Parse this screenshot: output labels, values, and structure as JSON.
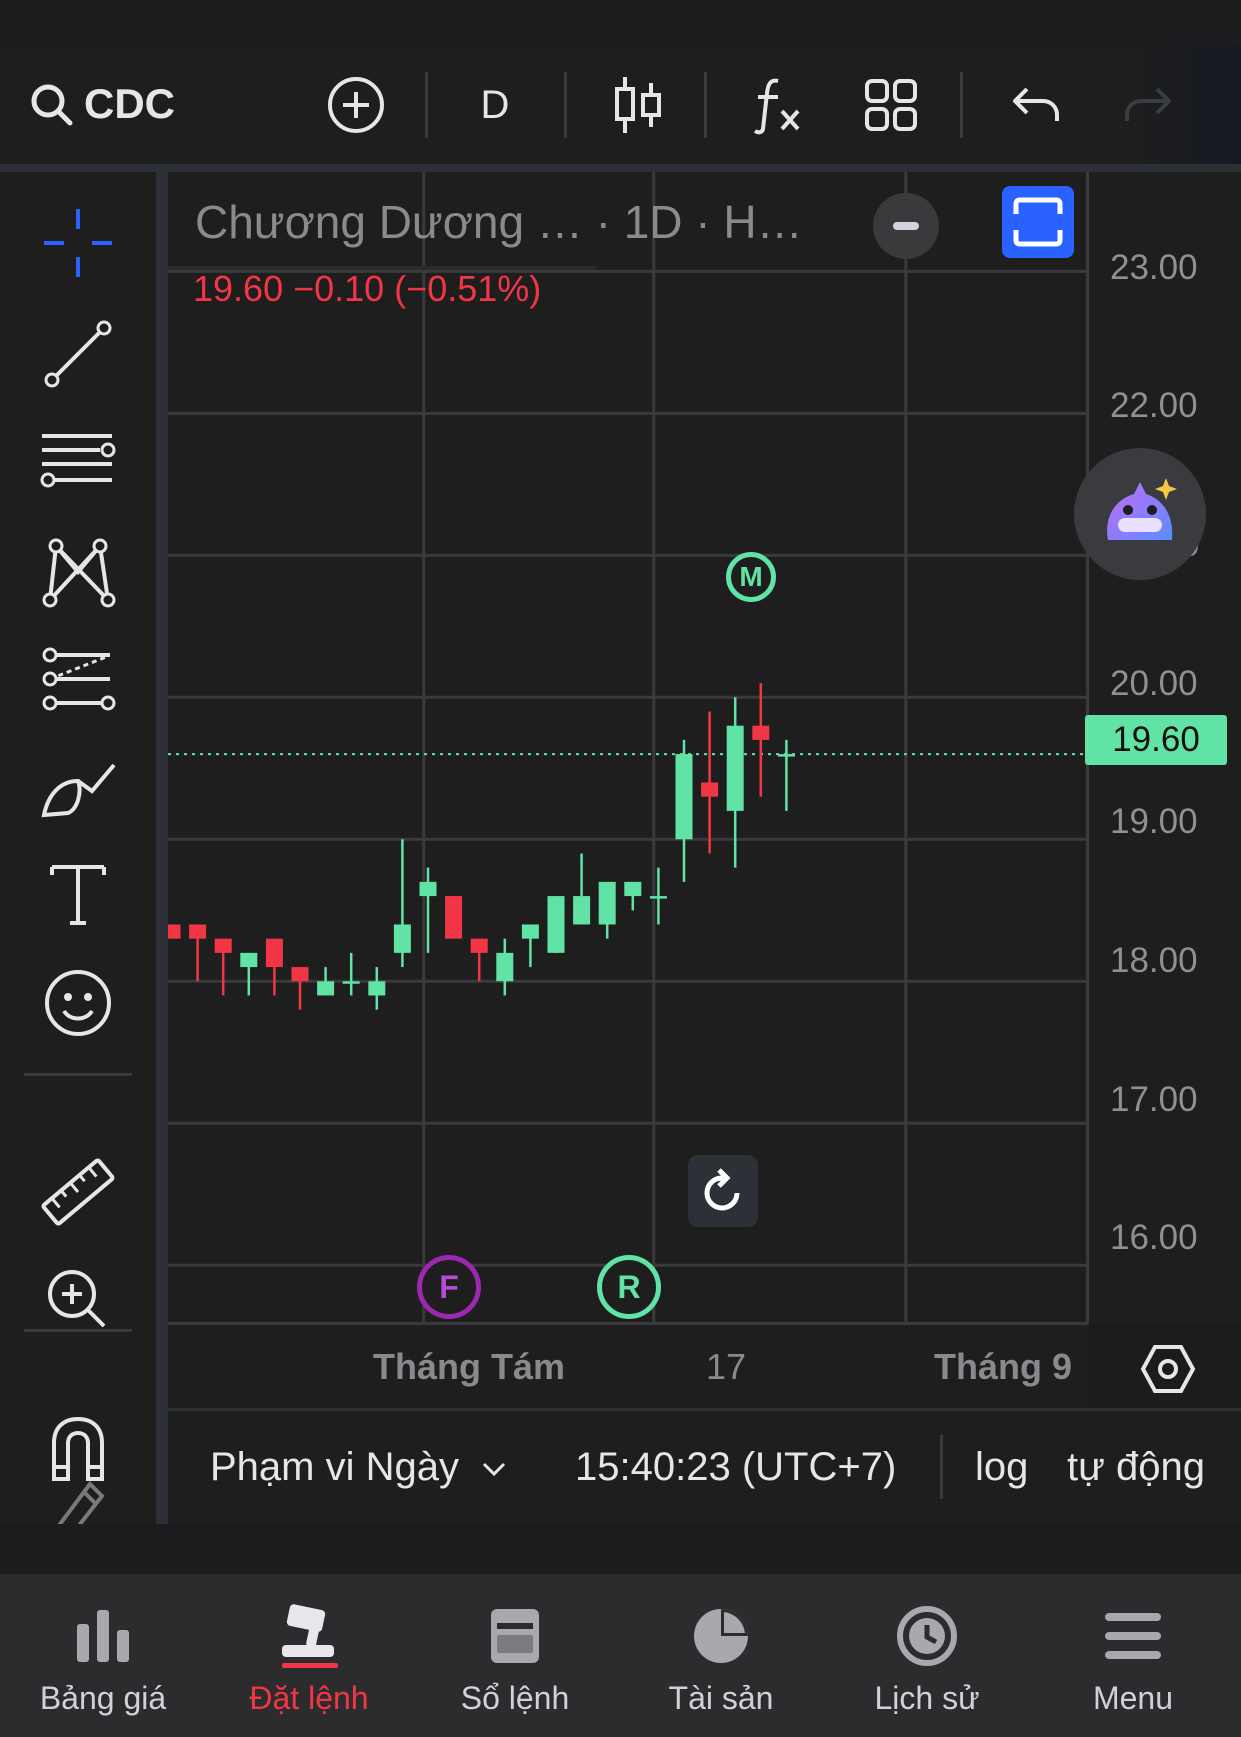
{
  "toolbar": {
    "symbol": "CDC",
    "interval": "D"
  },
  "legend": {
    "name": "Chương Dương … · 1D · H…",
    "price_change": "19.60  −0.10 (−0.51%)"
  },
  "colors": {
    "up": "#61e3a5",
    "down": "#f23645",
    "accent": "#2962ff",
    "background": "#1e1e1e"
  },
  "price_scale": {
    "ticks": [
      "23.00",
      "22.00",
      "20.00",
      "19.00",
      "18.00",
      "17.00",
      "16.00"
    ],
    "partial_tick": "0",
    "last_price": "19.60"
  },
  "time_axis": {
    "labels": [
      "Tháng Tám",
      "17",
      "Tháng 9"
    ]
  },
  "markers": {
    "m": "M",
    "f": "F",
    "r": "R"
  },
  "chart_data": {
    "type": "candlestick",
    "ylim": [
      15.6,
      23.7
    ],
    "last_price": 19.6,
    "x_labels": [
      "Tháng Tám",
      "17",
      "Tháng 9"
    ],
    "candles": [
      {
        "o": 18.4,
        "h": 18.4,
        "c": 18.3,
        "l": 18.3
      },
      {
        "o": 18.4,
        "h": 18.4,
        "c": 18.3,
        "l": 18.0
      },
      {
        "o": 18.3,
        "h": 18.3,
        "c": 18.2,
        "l": 17.9
      },
      {
        "o": 18.1,
        "h": 18.2,
        "c": 18.2,
        "l": 17.9
      },
      {
        "o": 18.3,
        "h": 18.3,
        "c": 18.1,
        "l": 17.9
      },
      {
        "o": 18.1,
        "h": 18.1,
        "c": 18.0,
        "l": 17.8
      },
      {
        "o": 17.9,
        "h": 18.1,
        "c": 18.0,
        "l": 17.9
      },
      {
        "o": 18.0,
        "h": 18.2,
        "c": 18.0,
        "l": 17.9
      },
      {
        "o": 17.9,
        "h": 18.1,
        "c": 18.0,
        "l": 17.8
      },
      {
        "o": 18.2,
        "h": 19.0,
        "c": 18.4,
        "l": 18.1
      },
      {
        "o": 18.6,
        "h": 18.8,
        "c": 18.7,
        "l": 18.2
      },
      {
        "o": 18.6,
        "h": 18.6,
        "c": 18.3,
        "l": 18.3
      },
      {
        "o": 18.3,
        "h": 18.3,
        "c": 18.2,
        "l": 18.0
      },
      {
        "o": 18.0,
        "h": 18.3,
        "c": 18.2,
        "l": 17.9
      },
      {
        "o": 18.3,
        "h": 18.4,
        "c": 18.4,
        "l": 18.1
      },
      {
        "o": 18.2,
        "h": 18.6,
        "c": 18.6,
        "l": 18.2
      },
      {
        "o": 18.4,
        "h": 18.9,
        "c": 18.6,
        "l": 18.4
      },
      {
        "o": 18.4,
        "h": 18.7,
        "c": 18.7,
        "l": 18.3
      },
      {
        "o": 18.6,
        "h": 18.7,
        "c": 18.7,
        "l": 18.5
      },
      {
        "o": 18.6,
        "h": 18.8,
        "c": 18.6,
        "l": 18.4
      },
      {
        "o": 19.0,
        "h": 19.7,
        "c": 19.6,
        "l": 18.7
      },
      {
        "o": 19.4,
        "h": 19.9,
        "c": 19.3,
        "l": 18.9
      },
      {
        "o": 19.2,
        "h": 20.0,
        "c": 19.8,
        "l": 18.8
      },
      {
        "o": 19.8,
        "h": 20.1,
        "c": 19.7,
        "l": 19.3
      },
      {
        "o": 19.6,
        "h": 19.7,
        "c": 19.6,
        "l": 19.2
      }
    ]
  },
  "nav": {
    "items": [
      {
        "label": "Bảng giá",
        "icon": "price-board-icon"
      },
      {
        "label": "Đặt lệnh",
        "icon": "gavel-icon",
        "active": true
      },
      {
        "label": "Sổ lệnh",
        "icon": "order-book-icon"
      },
      {
        "label": "Tài sản",
        "icon": "pie-chart-icon"
      },
      {
        "label": "Lịch sử",
        "icon": "clock-icon"
      },
      {
        "label": "Menu",
        "icon": "menu-icon"
      }
    ]
  },
  "infobar": {
    "range": "Phạm vi Ngày",
    "clock": "15:40:23 (UTC+7)",
    "log": "log",
    "auto": "tự động"
  }
}
